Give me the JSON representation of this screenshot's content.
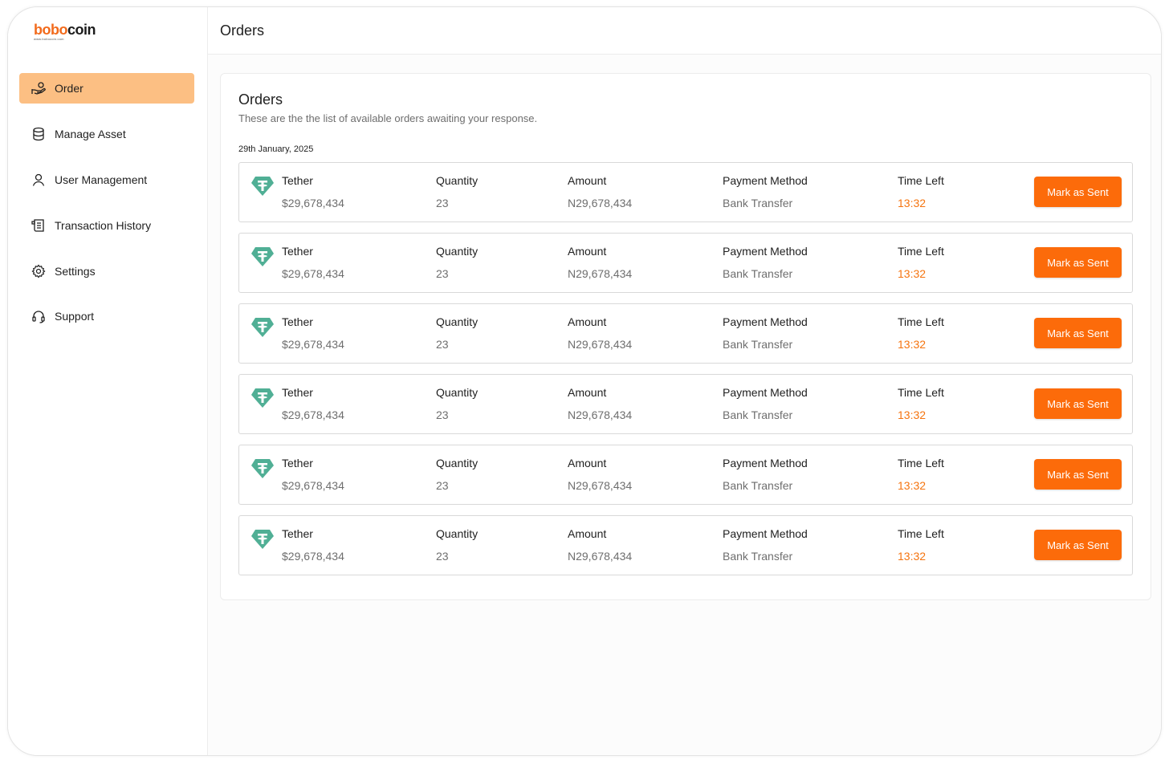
{
  "brand": {
    "logo_main": "bobo",
    "logo_coin": "coin",
    "logo_sub": "www.bobocoin.com",
    "accent": "#fc6b0a",
    "active_nav_bg": "#fcbf83",
    "tether_color": "#50af95"
  },
  "sidebar": {
    "items": [
      {
        "label": "Order",
        "icon": "hand-coin-icon",
        "active": true
      },
      {
        "label": "Manage Asset",
        "icon": "database-icon",
        "active": false
      },
      {
        "label": "User Management",
        "icon": "user-icon",
        "active": false
      },
      {
        "label": "Transaction History",
        "icon": "receipt-icon",
        "active": false
      },
      {
        "label": "Settings",
        "icon": "gear-icon",
        "active": false
      },
      {
        "label": "Support",
        "icon": "headset-icon",
        "active": false
      }
    ]
  },
  "header": {
    "title": "Orders"
  },
  "main": {
    "title": "Orders",
    "subtitle": "These are the the list of available orders awaiting your response.",
    "date": "29th January, 2025",
    "columns": {
      "quantity": "Quantity",
      "amount": "Amount",
      "payment": "Payment Method",
      "time": "Time Left"
    },
    "orders": [
      {
        "asset": "Tether",
        "price": "$29,678,434",
        "quantity": "23",
        "amount": "N29,678,434",
        "payment": "Bank Transfer",
        "time": "13:32",
        "button": "Mark as Sent"
      },
      {
        "asset": "Tether",
        "price": "$29,678,434",
        "quantity": "23",
        "amount": "N29,678,434",
        "payment": "Bank Transfer",
        "time": "13:32",
        "button": "Mark as Sent"
      },
      {
        "asset": "Tether",
        "price": "$29,678,434",
        "quantity": "23",
        "amount": "N29,678,434",
        "payment": "Bank Transfer",
        "time": "13:32",
        "button": "Mark as Sent"
      },
      {
        "asset": "Tether",
        "price": "$29,678,434",
        "quantity": "23",
        "amount": "N29,678,434",
        "payment": "Bank Transfer",
        "time": "13:32",
        "button": "Mark as Sent"
      },
      {
        "asset": "Tether",
        "price": "$29,678,434",
        "quantity": "23",
        "amount": "N29,678,434",
        "payment": "Bank Transfer",
        "time": "13:32",
        "button": "Mark as Sent"
      },
      {
        "asset": "Tether",
        "price": "$29,678,434",
        "quantity": "23",
        "amount": "N29,678,434",
        "payment": "Bank Transfer",
        "time": "13:32",
        "button": "Mark as Sent"
      }
    ]
  }
}
